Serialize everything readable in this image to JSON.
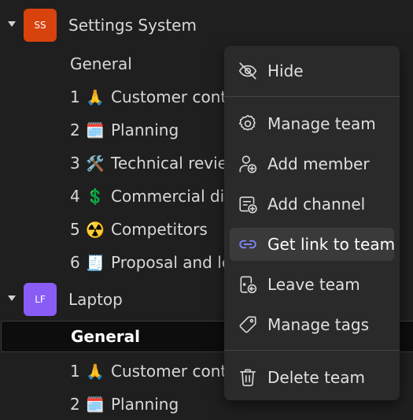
{
  "teams": [
    {
      "name": "Settings System",
      "initials": "SS",
      "color": "#d8420c",
      "channels": [
        {
          "num": "",
          "emoji": "",
          "name": "General"
        },
        {
          "num": "1",
          "emoji": "🙏",
          "name": "Customer conte"
        },
        {
          "num": "2",
          "emoji": "🗓️",
          "name": "Planning"
        },
        {
          "num": "3",
          "emoji": "🛠️",
          "name": "Technical review"
        },
        {
          "num": "4",
          "emoji": "💲",
          "name": "Commercial disc"
        },
        {
          "num": "5",
          "emoji": "☢️",
          "name": "Competitors"
        },
        {
          "num": "6",
          "emoji": "🧾",
          "name": "Proposal and le"
        }
      ]
    },
    {
      "name": "Laptop",
      "initials": "LF",
      "color": "#8a5cf6",
      "channels": [
        {
          "num": "",
          "emoji": "",
          "name": "General"
        },
        {
          "num": "1",
          "emoji": "🙏",
          "name": "Customer conte"
        },
        {
          "num": "2",
          "emoji": "🗓️",
          "name": "Planning"
        }
      ]
    }
  ],
  "menu": {
    "items": [
      {
        "label": "Hide",
        "icon": "eye-off-icon"
      },
      {
        "label": "Manage team",
        "icon": "gear-icon"
      },
      {
        "label": "Add member",
        "icon": "add-person-icon"
      },
      {
        "label": "Add channel",
        "icon": "add-channel-icon"
      },
      {
        "label": "Get link to team",
        "icon": "link-icon"
      },
      {
        "label": "Leave team",
        "icon": "leave-icon"
      },
      {
        "label": "Manage tags",
        "icon": "tag-icon"
      },
      {
        "label": "Delete team",
        "icon": "trash-icon"
      }
    ],
    "active_color": "#7f85f5"
  }
}
